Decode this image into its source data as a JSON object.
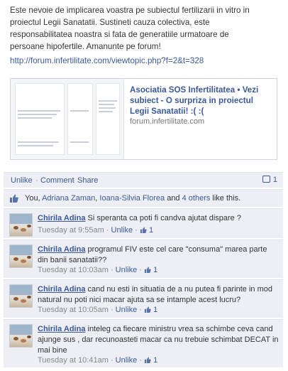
{
  "post": {
    "line1": "Este nevoie de implicarea voastra pe subiectul fertilizarii in vitro in",
    "line2": "proiectul Legii Sanatatii. Sustineti cauza colectiva, este",
    "line3": "responsabilitatea noastra si fata de generatiile urmatoare de",
    "line4": "persoane hipofertile. Amanunte pe forum!",
    "link": "http://forum.infertilitate.com/viewtopic.php?f=2&t=328"
  },
  "share_card": {
    "title": "Asociatia SOS Infertilitatea • Vezi subiect - O surpriza in proiectul Legii Sanatatii! :( :(",
    "domain": "forum.infertilitate.com"
  },
  "actions": {
    "unlike": "Unlike",
    "comment": "Comment",
    "share": "Share",
    "comment_count": "1"
  },
  "likes": {
    "you": "You, ",
    "person1": "Adriana Zaman",
    "sep1": ", ",
    "person2": "Ioana-Silvia Florea",
    "and": " and ",
    "others": "4 others",
    "suffix": " like this."
  },
  "comments": [
    {
      "author": "Chirila Adina",
      "text": " Si speranta ca poti fi candva ajutat dispare ?",
      "time": "Tuesday at 9:55am",
      "unlike": "Unlike",
      "likes": "1"
    },
    {
      "author": "Chirila Adina",
      "text": " programul FIV este cel care \"consuma\" marea parte din banii sanatatii??",
      "time": "Tuesday at 10:03am",
      "unlike": "Unlike",
      "likes": "1"
    },
    {
      "author": "Chirila Adina",
      "text": " cand nu esti in situatia de a nu putea fi parinte in mod natural nu poti nici macar ajuta sa se intample acest lucru?",
      "time": "Tuesday at 10:05am",
      "unlike": "Unlike",
      "likes": "1"
    },
    {
      "author": "Chirila Adina",
      "text": " inteleg ca fiecare ministru vrea sa schimbe ceva cand ajunge sus , dar recunoasteti macar ca nu trebuie schimbat DECAT in mai bine",
      "time": "Tuesday at 10:41am",
      "unlike": "Unlike",
      "likes": "1"
    }
  ],
  "meta_sep": " · ",
  "colors": {
    "link": "#3b5998",
    "panel_bg": "#edeff4"
  }
}
